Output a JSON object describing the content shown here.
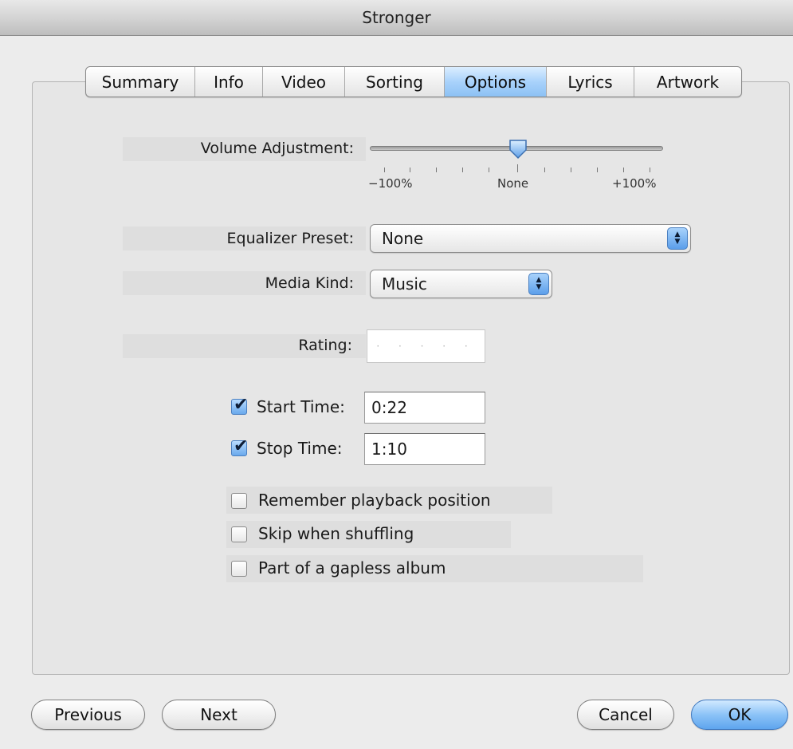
{
  "window": {
    "title": "Stronger"
  },
  "tabs": [
    {
      "label": "Summary",
      "active": false
    },
    {
      "label": "Info",
      "active": false
    },
    {
      "label": "Video",
      "active": false
    },
    {
      "label": "Sorting",
      "active": false
    },
    {
      "label": "Options",
      "active": true
    },
    {
      "label": "Lyrics",
      "active": false
    },
    {
      "label": "Artwork",
      "active": false
    }
  ],
  "volume": {
    "label": "Volume Adjustment:",
    "min_label": "−100%",
    "mid_label": "None",
    "max_label": "+100%",
    "value_percent": 0
  },
  "equalizer": {
    "label": "Equalizer Preset:",
    "value": "None"
  },
  "media_kind": {
    "label": "Media Kind:",
    "value": "Music"
  },
  "rating": {
    "label": "Rating:",
    "stars": "· · · · ·",
    "value": 0
  },
  "start_time": {
    "label": "Start Time:",
    "value": "0:22",
    "checked": true
  },
  "stop_time": {
    "label": "Stop Time:",
    "value": "1:10",
    "checked": true
  },
  "options": [
    {
      "label": "Remember playback position",
      "checked": false
    },
    {
      "label": "Skip when shuffling",
      "checked": false
    },
    {
      "label": "Part of a gapless album",
      "checked": false
    }
  ],
  "buttons": {
    "previous": "Previous",
    "next": "Next",
    "cancel": "Cancel",
    "ok": "OK"
  },
  "colors": {
    "accent": "#8cc1f4",
    "window_bg": "#ececec"
  }
}
